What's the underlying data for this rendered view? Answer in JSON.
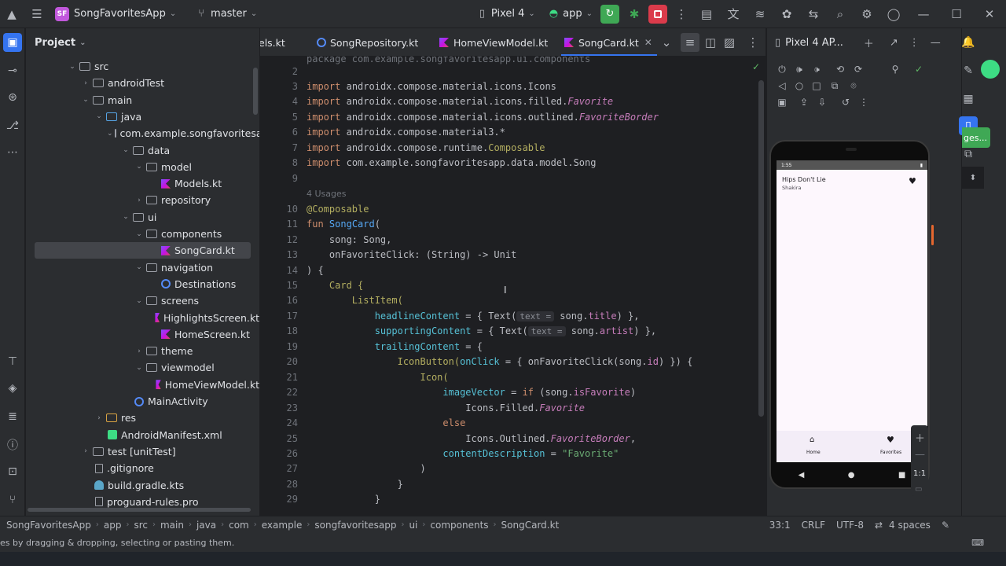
{
  "titlebar": {
    "project_badge": "SF",
    "project_name": "SongFavoritesApp",
    "branch": "master",
    "device": "Pixel 4",
    "run_config": "app"
  },
  "project_panel": {
    "title": "Project",
    "tree": [
      {
        "label": "src",
        "type": "folder",
        "depth": 0,
        "expanded": true
      },
      {
        "label": "androidTest",
        "type": "folder",
        "depth": 1,
        "expanded": false
      },
      {
        "label": "main",
        "type": "folder",
        "depth": 1,
        "expanded": true
      },
      {
        "label": "java",
        "type": "src-folder",
        "depth": 2,
        "expanded": true
      },
      {
        "label": "com.example.songfavoritesapp",
        "type": "folder",
        "depth": 3,
        "expanded": true
      },
      {
        "label": "data",
        "type": "folder",
        "depth": 4,
        "expanded": true
      },
      {
        "label": "model",
        "type": "folder",
        "depth": 5,
        "expanded": true
      },
      {
        "label": "Models.kt",
        "type": "kt",
        "depth": 6
      },
      {
        "label": "repository",
        "type": "folder",
        "depth": 5,
        "expanded": false
      },
      {
        "label": "ui",
        "type": "folder",
        "depth": 4,
        "expanded": true
      },
      {
        "label": "components",
        "type": "folder",
        "depth": 5,
        "expanded": true
      },
      {
        "label": "SongCard.kt",
        "type": "kt",
        "depth": 6,
        "selected": true
      },
      {
        "label": "navigation",
        "type": "folder",
        "depth": 5,
        "expanded": true
      },
      {
        "label": "Destinations",
        "type": "class",
        "depth": 6
      },
      {
        "label": "screens",
        "type": "folder",
        "depth": 5,
        "expanded": true
      },
      {
        "label": "HighlightsScreen.kt",
        "type": "kt",
        "depth": 6
      },
      {
        "label": "HomeScreen.kt",
        "type": "kt",
        "depth": 6
      },
      {
        "label": "theme",
        "type": "folder",
        "depth": 5,
        "expanded": false
      },
      {
        "label": "viewmodel",
        "type": "folder",
        "depth": 5,
        "expanded": true
      },
      {
        "label": "HomeViewModel.kt",
        "type": "kt",
        "depth": 6
      },
      {
        "label": "MainActivity",
        "type": "class",
        "depth": 4
      },
      {
        "label": "res",
        "type": "res-folder",
        "depth": 2,
        "expanded": false
      },
      {
        "label": "AndroidManifest.xml",
        "type": "xml",
        "depth": 2
      },
      {
        "label": "test [unitTest]",
        "type": "folder",
        "depth": 1,
        "expanded": false
      },
      {
        "label": ".gitignore",
        "type": "file",
        "depth": 1
      },
      {
        "label": "build.gradle.kts",
        "type": "gradle",
        "depth": 1
      },
      {
        "label": "proguard-rules.pro",
        "type": "file",
        "depth": 1
      }
    ]
  },
  "tabs": [
    {
      "label": "els.kt",
      "active": false
    },
    {
      "label": "SongRepository.kt",
      "active": false
    },
    {
      "label": "HomeViewModel.kt",
      "active": false
    },
    {
      "label": "SongCard.kt",
      "active": true
    }
  ],
  "editor": {
    "usages_label": "4 Usages",
    "hint_text": "text =",
    "line_numbers": [
      "2",
      "3",
      "4",
      "5",
      "6",
      "7",
      "8",
      "9",
      "10",
      "11",
      "12",
      "13",
      "14",
      "15",
      "16",
      "17",
      "18",
      "19",
      "20",
      "21",
      "22",
      "23",
      "24",
      "25",
      "26",
      "27",
      "28",
      "29"
    ],
    "code": {
      "import_kw": "import",
      "imp1": "androidx.compose.material.icons.Icons",
      "imp2_a": "androidx.compose.material.icons.filled.",
      "imp2_b": "Favorite",
      "imp3_a": "androidx.compose.material.icons.outlined.",
      "imp3_b": "FavoriteBorder",
      "imp4": "androidx.compose.material3.*",
      "imp5_a": "androidx.compose.runtime.",
      "imp5_b": "Composable",
      "imp6": "com.example.songfavoritesapp.data.model.Song",
      "composable": "@Composable",
      "fun_kw": "fun",
      "fun_name": "SongCard",
      "open_paren": "(",
      "param1": "    song: Song,",
      "param2": "    onFavoriteClick: (String) -> Unit",
      "close_sig": ") {",
      "card": "    Card {",
      "list_item": "        ListItem(",
      "headline_name": "            headlineContent",
      "headline_a": " = { Text(",
      "headline_b": " song.",
      "headline_prop": "title",
      "headline_c": ") },",
      "supporting_name": "            supportingContent",
      "supporting_a": " = { Text(",
      "supporting_b": " song.",
      "supporting_prop": "artist",
      "supporting_c": ") },",
      "trailing_name": "            trailingContent",
      "trailing_a": " = {",
      "iconbutton_a": "                IconButton(",
      "iconbutton_name": "onClick",
      "iconbutton_b": " = { onFavoriteClick(song.",
      "iconbutton_prop": "id",
      "iconbutton_c": ") }) {",
      "icon_open": "                    Icon(",
      "image_vector_name": "                        imageVector",
      "image_vector_a": " = ",
      "if_kw": "if",
      "image_vector_b": " (song.",
      "image_vector_prop": "isFavorite",
      "image_vector_c": ")",
      "filled_a": "                            Icons.Filled.",
      "filled_b": "Favorite",
      "else_kw": "                        else",
      "outlined_a": "                            Icons.Outlined.",
      "outlined_b": "FavoriteBorder",
      "outlined_c": ",",
      "content_desc_name": "                        contentDescription",
      "content_desc_a": " = ",
      "content_desc_str": "\"Favorite\"",
      "close1": "                    )",
      "close2": "                }",
      "close3": "            }"
    }
  },
  "devices_panel": {
    "title": "Pixel 4 AP...",
    "phone": {
      "status_time": "1:55",
      "song_title": "Hips Don't Lie",
      "song_artist": "Shakira",
      "nav_home": "Home",
      "nav_favorites": "Favorites",
      "zoom_ratio": "1:1"
    }
  },
  "right_strip": {
    "badge_text": "ges..."
  },
  "statusbar": {
    "breadcrumbs": [
      "SongFavoritesApp",
      "app",
      "src",
      "main",
      "java",
      "com",
      "example",
      "songfavoritesapp",
      "ui",
      "components",
      "SongCard.kt"
    ],
    "position": "33:1",
    "line_ending": "CRLF",
    "encoding": "UTF-8",
    "indent": "4 spaces"
  },
  "hint_bar": {
    "text": "es by dragging & dropping, selecting or pasting them."
  }
}
